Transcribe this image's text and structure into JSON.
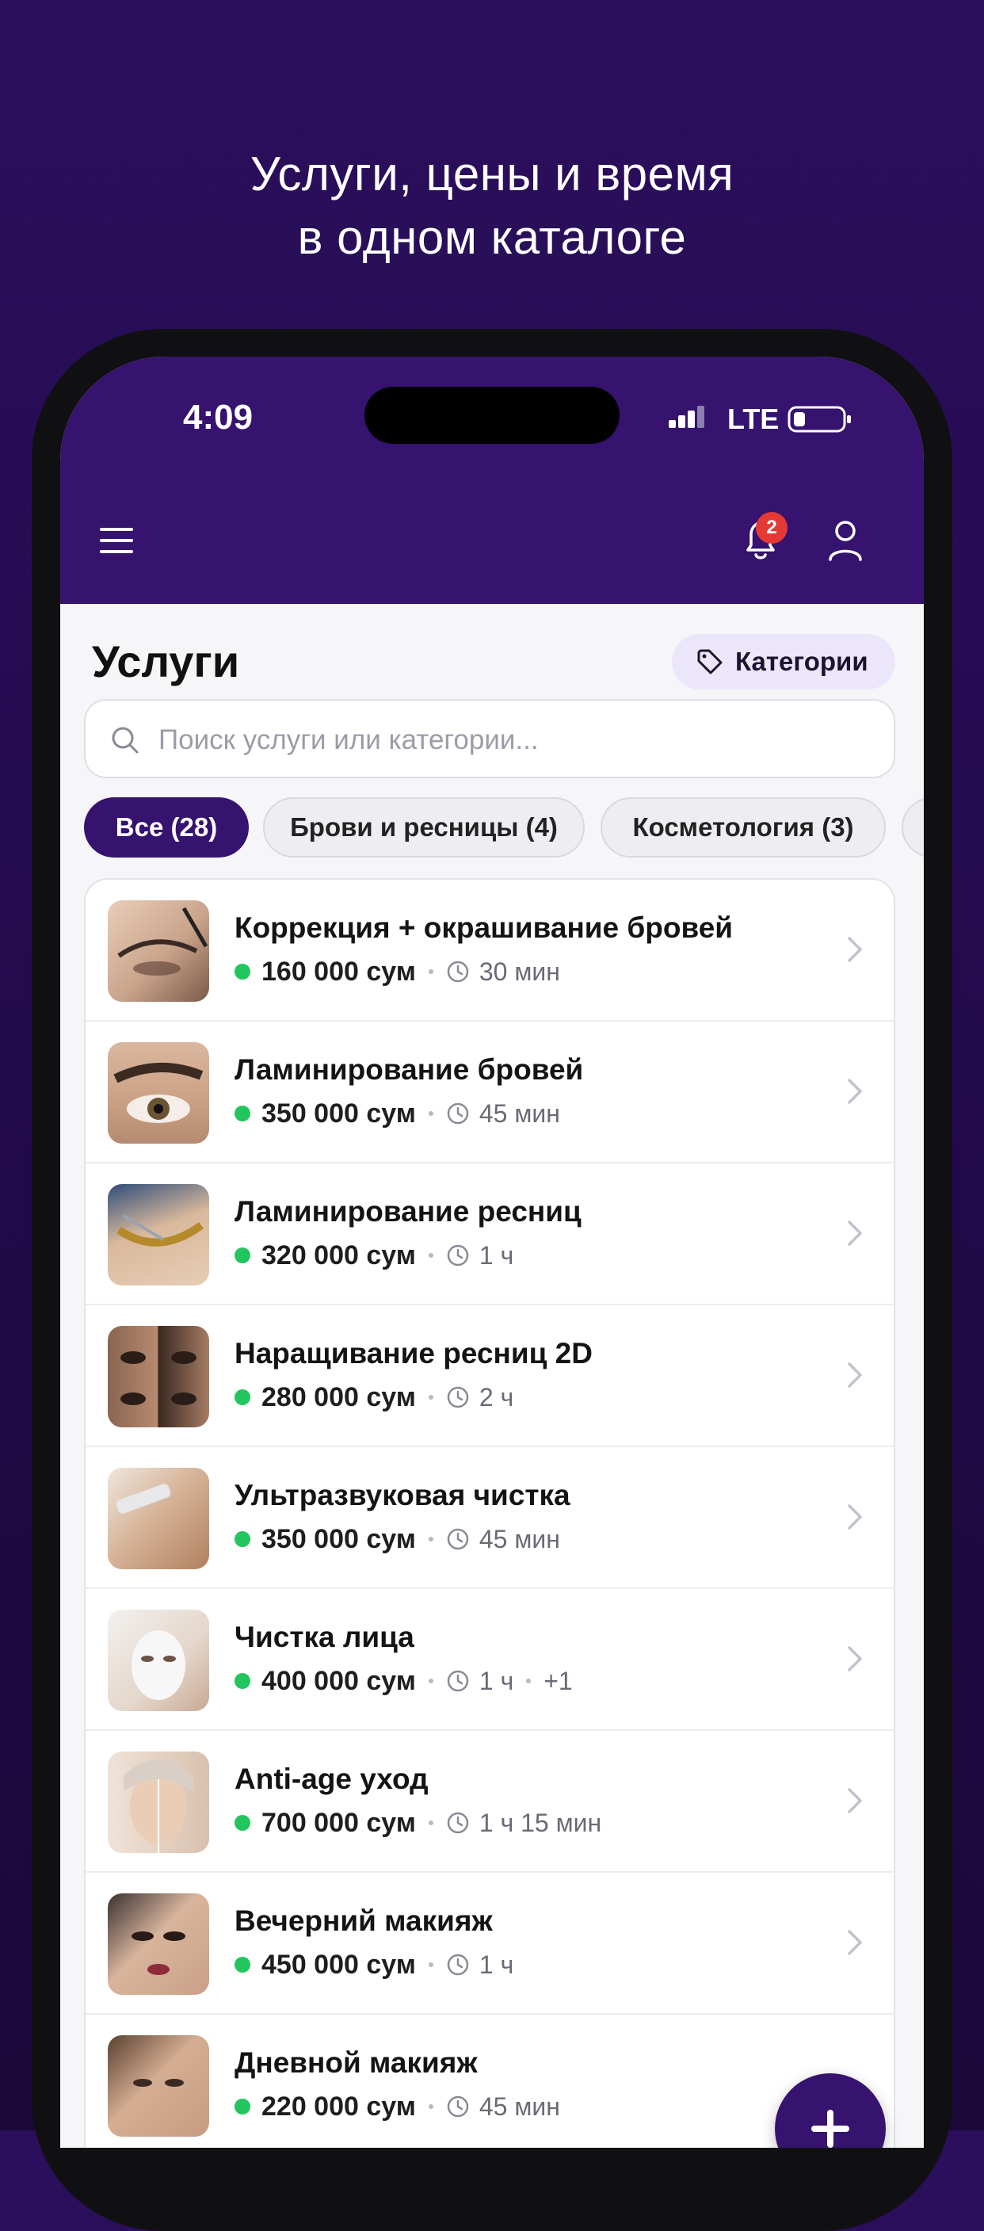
{
  "promo": {
    "headline_line1": "Услуги, цены и время",
    "headline_line2": "в одном каталоге"
  },
  "status_bar": {
    "time": "4:09",
    "network": "LTE"
  },
  "header": {
    "notification_count": "2",
    "icons": [
      "menu-icon",
      "bell-icon",
      "user-icon"
    ]
  },
  "page": {
    "title": "Услуги",
    "categories_button": "Категории"
  },
  "search": {
    "placeholder": "Поиск услуги или категории..."
  },
  "filters": [
    {
      "label": "Все (28)",
      "active": true
    },
    {
      "label": "Брови и ресницы (4)",
      "active": false
    },
    {
      "label": "Косметология (3)",
      "active": false
    }
  ],
  "services": [
    {
      "name": "Коррекция + окрашивание бровей",
      "price": "160 000 сум",
      "duration": "30 мин",
      "extra": ""
    },
    {
      "name": "Ламинирование бровей",
      "price": "350 000 сум",
      "duration": "45 мин",
      "extra": ""
    },
    {
      "name": "Ламинирование ресниц",
      "price": "320 000 сум",
      "duration": "1 ч",
      "extra": ""
    },
    {
      "name": "Наращивание ресниц 2D",
      "price": "280 000 сум",
      "duration": "2 ч",
      "extra": ""
    },
    {
      "name": "Ультразвуковая чистка",
      "price": "350 000 сум",
      "duration": "45 мин",
      "extra": ""
    },
    {
      "name": "Чистка лица",
      "price": "400 000 сум",
      "duration": "1 ч",
      "extra": "+1"
    },
    {
      "name": "Anti-age уход",
      "price": "700 000 сум",
      "duration": "1 ч 15 мин",
      "extra": ""
    },
    {
      "name": "Вечерний макияж",
      "price": "450 000 сум",
      "duration": "1 ч",
      "extra": ""
    },
    {
      "name": "Дневной макияж",
      "price": "220 000 сум",
      "duration": "45 мин",
      "extra": ""
    }
  ],
  "colors": {
    "brand_purple": "#35136e",
    "background": "#2b0f5c",
    "available_dot": "#22c55e",
    "badge_red": "#e53935"
  }
}
